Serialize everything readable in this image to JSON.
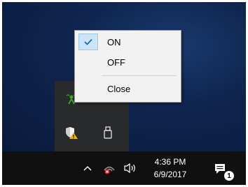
{
  "context_menu": {
    "items": [
      {
        "label": "ON",
        "checked": true
      },
      {
        "label": "OFF",
        "checked": false
      },
      {
        "label": "Close",
        "checked": false
      }
    ]
  },
  "tray_overflow": {
    "icons": [
      "network-activity-icon",
      "usb-drive-icon",
      "security-shield-warning-icon",
      "usb-eject-icon"
    ]
  },
  "taskbar": {
    "icons": [
      "chevron-up-icon",
      "network-disconnected-icon",
      "speaker-icon",
      "action-center-icon"
    ],
    "clock": {
      "time": "4:36 PM",
      "date": "6/9/2017"
    },
    "notification_count": "1"
  },
  "colors": {
    "taskbar_bg": "#101010",
    "menu_bg": "#f2f2f2",
    "menu_highlight": "#cce4f7",
    "checkmark": "#0063b1"
  }
}
